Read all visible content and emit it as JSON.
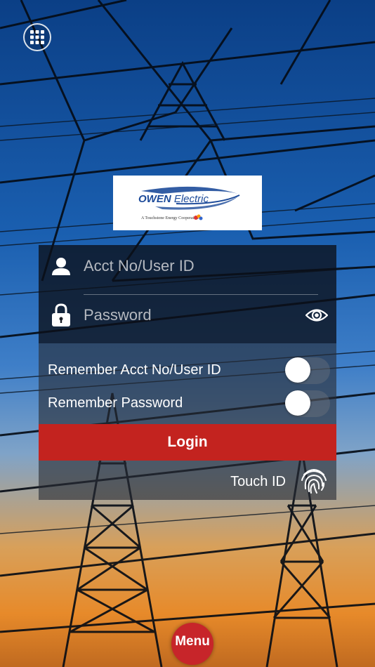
{
  "header": {
    "grid_icon": "grid-menu-icon"
  },
  "logo": {
    "brand_bold": "OWEN",
    "brand_light": " Electric",
    "tagline": "A Touchstone Energy Cooperative",
    "brand_color": "#1d4b9a"
  },
  "login_form": {
    "user_placeholder": "Acct No/User ID",
    "password_placeholder": "Password",
    "user_icon": "person-icon",
    "lock_icon": "lock-icon",
    "eye_icon": "eye-icon"
  },
  "options": {
    "remember_user_label": "Remember Acct No/User ID",
    "remember_user_on": false,
    "remember_password_label": "Remember Password",
    "remember_password_on": false
  },
  "actions": {
    "login_label": "Login",
    "touch_id_label": "Touch ID",
    "fingerprint_icon": "fingerprint-icon",
    "menu_label": "Menu"
  },
  "colors": {
    "login_button": "#c3231f",
    "menu_button": "#c7252a"
  }
}
